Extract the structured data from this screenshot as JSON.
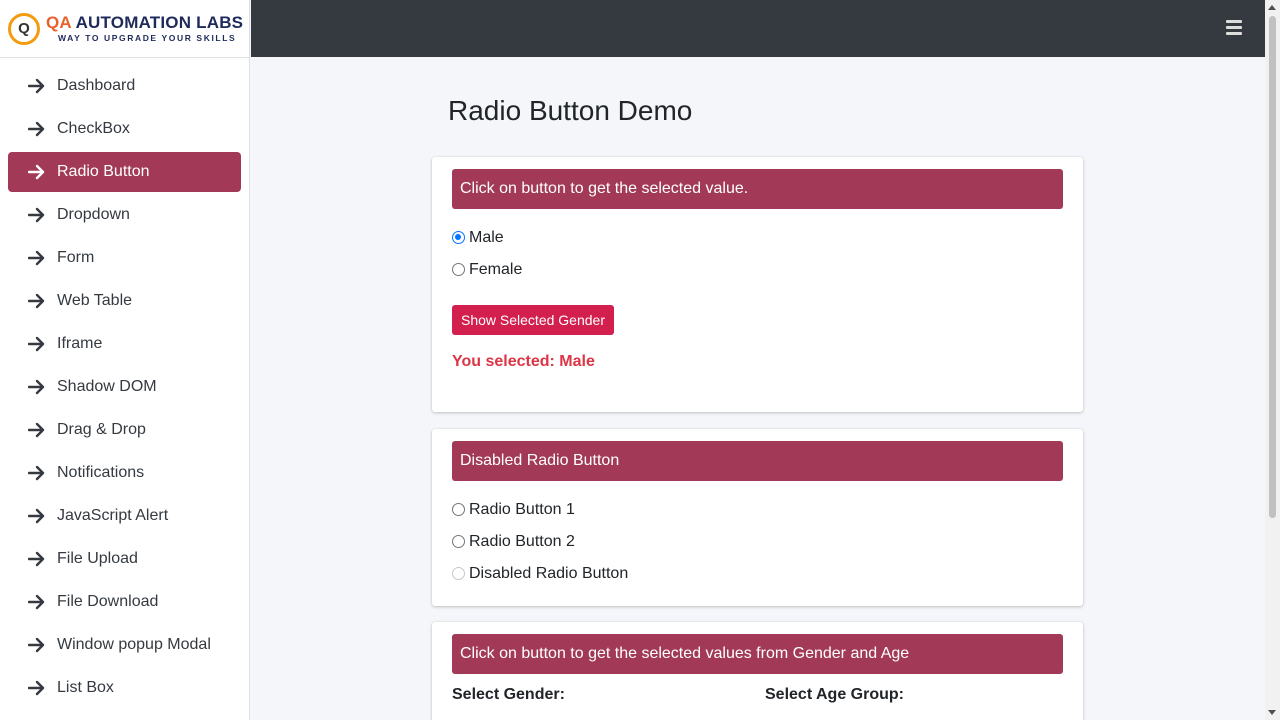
{
  "brand": {
    "logo_letter": "Q",
    "title_qa": "QA",
    "title_rest": " AUTOMATION LABS",
    "subtitle": "WAY TO UPGRADE YOUR SKILLS"
  },
  "sidebar": {
    "items": [
      {
        "label": "Dashboard",
        "active": false
      },
      {
        "label": "CheckBox",
        "active": false
      },
      {
        "label": "Radio Button",
        "active": true
      },
      {
        "label": "Dropdown",
        "active": false
      },
      {
        "label": "Form",
        "active": false
      },
      {
        "label": "Web Table",
        "active": false
      },
      {
        "label": "Iframe",
        "active": false
      },
      {
        "label": "Shadow DOM",
        "active": false
      },
      {
        "label": "Drag & Drop",
        "active": false
      },
      {
        "label": "Notifications",
        "active": false
      },
      {
        "label": "JavaScript Alert",
        "active": false
      },
      {
        "label": "File Upload",
        "active": false
      },
      {
        "label": "File Download",
        "active": false
      },
      {
        "label": "Window popup Modal",
        "active": false
      },
      {
        "label": "List Box",
        "active": false
      }
    ]
  },
  "topbar": {
    "menu_icon": "hamburger-icon"
  },
  "main": {
    "page_title": "Radio Button Demo",
    "card1": {
      "header": "Click on button to get the selected value.",
      "options": [
        {
          "label": "Male",
          "checked": true
        },
        {
          "label": "Female",
          "checked": false
        }
      ],
      "button_label": "Show Selected Gender",
      "result_text": "You selected: Male"
    },
    "card2": {
      "header": "Disabled Radio Button",
      "options": [
        {
          "label": "Radio Button 1",
          "disabled": false
        },
        {
          "label": "Radio Button 2",
          "disabled": false
        },
        {
          "label": "Disabled Radio Button",
          "disabled": true
        }
      ]
    },
    "card3": {
      "header": "Click on button to get the selected values from Gender and Age",
      "gender_heading": "Select Gender:",
      "age_heading": "Select Age Group:"
    }
  },
  "colors": {
    "accent": "#a23a57",
    "button": "#d21f4e",
    "topbar": "#343a40",
    "result": "#dc3545",
    "radio_checked": "#0075ff"
  }
}
